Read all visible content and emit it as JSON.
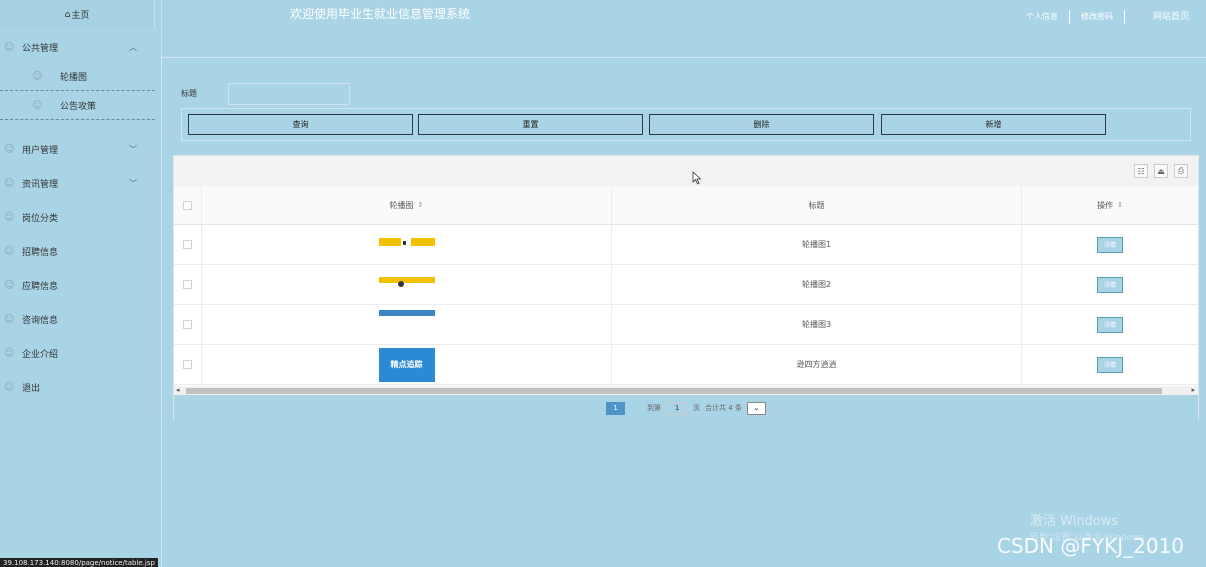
{
  "app": {
    "title": "欢迎使用毕业生就业信息管理系统",
    "home_label": "主页",
    "top_links": [
      "个人信息",
      "修改密码",
      "网站首页"
    ]
  },
  "sidebar": {
    "items": [
      {
        "label": "公共管理",
        "expanded": true,
        "children": [
          "轮播图",
          "公告攻策"
        ]
      },
      {
        "label": "用户管理",
        "expanded": false
      },
      {
        "label": "资讯管理",
        "expanded": false
      },
      {
        "label": "岗位分类"
      },
      {
        "label": "招聘信息"
      },
      {
        "label": "应聘信息"
      },
      {
        "label": "咨询信息"
      },
      {
        "label": "企业介绍"
      },
      {
        "label": "退出"
      }
    ]
  },
  "search": {
    "label": "标题",
    "value": "",
    "placeholder": ""
  },
  "actions": {
    "query": "查询",
    "reset": "重置",
    "delete": "删除",
    "add": "新增"
  },
  "table": {
    "columns": [
      "轮播图",
      "标题",
      "操作"
    ],
    "rows": [
      {
        "image": "banner-1",
        "title": "轮播图1",
        "action": "详情"
      },
      {
        "image": "banner-2",
        "title": "轮播图2",
        "action": "详情"
      },
      {
        "image": "banner-3",
        "title": "轮播图3",
        "action": "详情"
      },
      {
        "image": "banner-4",
        "image_text": "精点追踪",
        "title": "逊四方逍逍",
        "action": "详情"
      }
    ]
  },
  "pagination": {
    "current_page": "1",
    "goto_label": "到第",
    "goto_value": "1",
    "page_unit": "页",
    "total_text": "合计共 4 条",
    "page_size": ""
  },
  "browser_status_url": "39.108.173.140:8080/page/notice/table.jsp",
  "os_overlay": {
    "activate_title": "激活 Windows",
    "activate_sub": "转到\"设置\"以激活 Windows"
  },
  "watermark": "CSDN @FYKJ_2010",
  "colors": {
    "background": "#a9d4e6",
    "button_border": "#2a3b43",
    "pager_active": "#4f93c8"
  }
}
